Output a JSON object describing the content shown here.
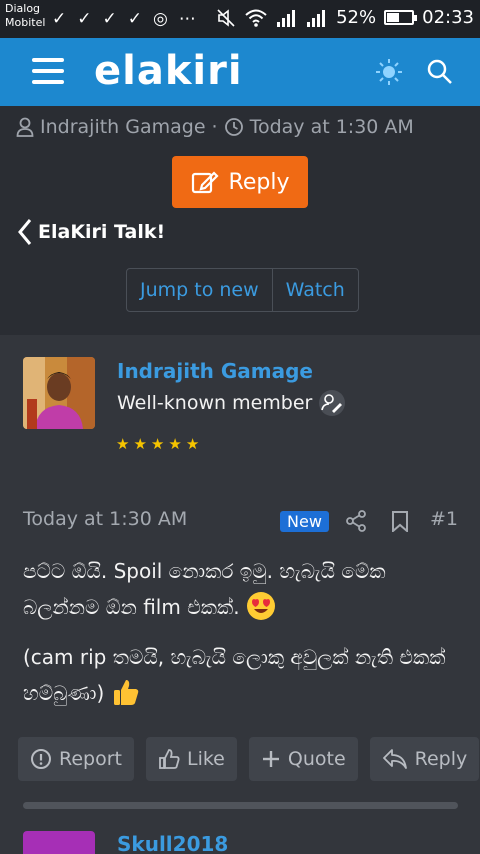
{
  "status_bar": {
    "carrier_line1": "Dialog",
    "carrier_line2": "Mobitel",
    "battery_percent": "52%",
    "battery_level": 0.52,
    "time": "02:33"
  },
  "header": {
    "logo_text": "elakiri",
    "menu_icon": "hamburger-icon",
    "theme_icon": "sun-icon",
    "search_icon": "search-icon"
  },
  "thread": {
    "author": "Indrajith Gamage",
    "separator": "·",
    "time": "Today at 1:30 AM",
    "reply_label": "Reply",
    "back_label": "ElaKiri Talk!",
    "jump_label": "Jump to new",
    "watch_label": "Watch"
  },
  "post": {
    "username": "Indrajith Gamage",
    "user_title": "Well-known member",
    "star_rating": 5,
    "date": "Today at 1:30 AM",
    "new_badge": "New",
    "number": "#1",
    "paragraph1": "පට්ට ඕයි. Spoil නොකර ඉමු. හැබැයි මේක බලන්නම ඕන film එකක්.",
    "paragraph2": "(cam rip තමයි, හැබැයි ලොකු අවුලක් නැති එකක් හම්බුණා)",
    "emoji1": "heart-eyes-emoji",
    "emoji2": "thumbs-up-emoji",
    "actions": {
      "report": "Report",
      "like": "Like",
      "quote": "Quote",
      "reply": "Reply"
    }
  },
  "next_post": {
    "username": "Skull2018"
  },
  "colors": {
    "background": "#2a2d33",
    "header": "#1d88cf",
    "accent_link": "#3b9be0",
    "reply_button": "#f06a14",
    "new_badge": "#1d6fd6",
    "stars": "#f5c400"
  }
}
